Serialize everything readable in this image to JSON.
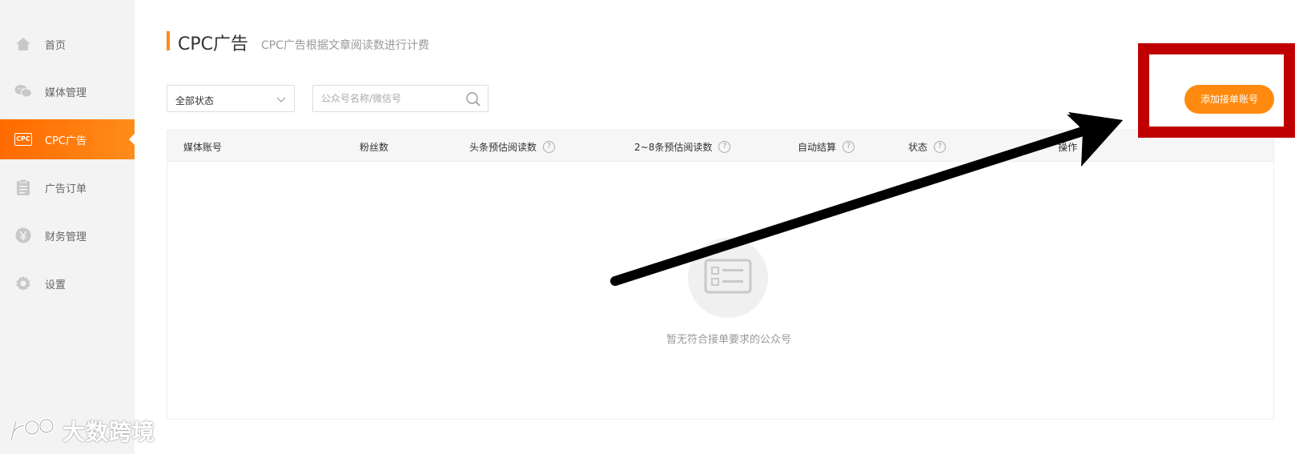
{
  "sidebar": {
    "items": [
      {
        "label": "首页",
        "icon": "home-icon"
      },
      {
        "label": "媒体管理",
        "icon": "wechat-icon"
      },
      {
        "label": "CPC广告",
        "icon": "cpc-icon",
        "badge": "CPC",
        "active": true
      },
      {
        "label": "广告订单",
        "icon": "clipboard-icon"
      },
      {
        "label": "财务管理",
        "icon": "yuan-icon"
      },
      {
        "label": "设置",
        "icon": "gear-icon"
      }
    ]
  },
  "header": {
    "title": "CPC广告",
    "subtitle": "CPC广告根据文章阅读数进行计费"
  },
  "filters": {
    "status_value": "全部状态",
    "search_placeholder": "公众号名称/微信号"
  },
  "actions": {
    "add_account_label": "添加接单账号"
  },
  "table": {
    "columns": [
      {
        "label": "媒体账号",
        "help": false
      },
      {
        "label": "粉丝数",
        "help": false
      },
      {
        "label": "头条预估阅读数",
        "help": true
      },
      {
        "label": "2~8条预估阅读数",
        "help": true
      },
      {
        "label": "自动结算",
        "help": true
      },
      {
        "label": "状态",
        "help": true
      },
      {
        "label": "操作",
        "help": false
      }
    ],
    "rows": [],
    "empty_text": "暂无符合接单要求的公众号"
  },
  "watermark": {
    "text": "大数跨境"
  },
  "colors": {
    "accent": "#ff8a0f",
    "highlight": "#c00000",
    "arrow": "#000000"
  }
}
